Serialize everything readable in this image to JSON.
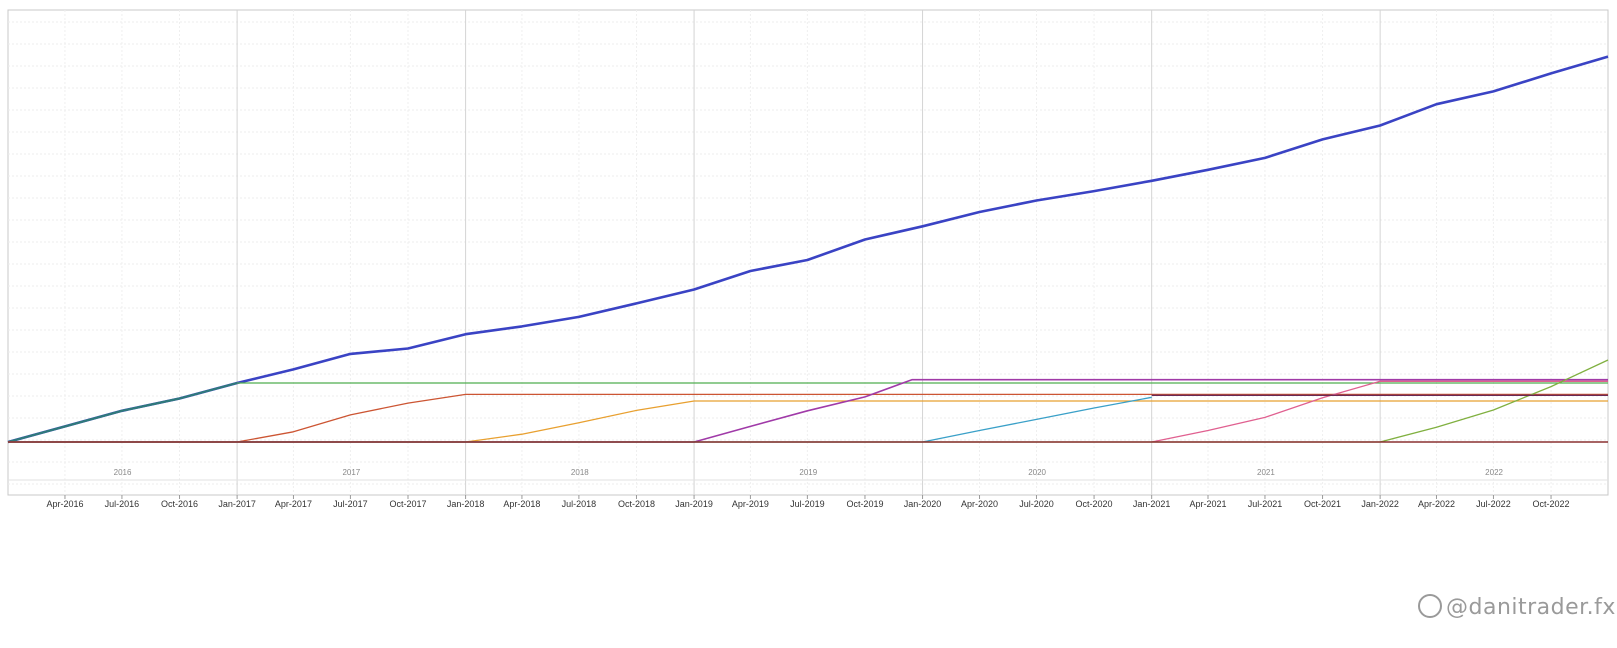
{
  "chart_data": {
    "type": "line",
    "title": "",
    "xlabel": "",
    "ylabel": "",
    "xlim": [
      "2016-01-01",
      "2022-12-31"
    ],
    "ylim": [
      0,
      100
    ],
    "grid": true,
    "legend": "none",
    "y_tick_labels_visible": false,
    "x_ticks": [
      "Apr-2016",
      "Jul-2016",
      "Oct-2016",
      "Jan-2017",
      "Apr-2017",
      "Jul-2017",
      "Oct-2017",
      "Jan-2018",
      "Apr-2018",
      "Jul-2018",
      "Oct-2018",
      "Jan-2019",
      "Apr-2019",
      "Jul-2019",
      "Oct-2019",
      "Jan-2020",
      "Apr-2020",
      "Jul-2020",
      "Oct-2020",
      "Jan-2021",
      "Apr-2021",
      "Jul-2021",
      "Oct-2021",
      "Jan-2022",
      "Apr-2022",
      "Jul-2022",
      "Oct-2022"
    ],
    "year_labels": [
      "2016",
      "2017",
      "2018",
      "2019",
      "2020",
      "2021",
      "2022"
    ],
    "series": [
      {
        "color": "#3a43c4",
        "width": 2.6,
        "x": [
          "2016-01-01",
          "2016-04-01",
          "2016-07-01",
          "2016-10-01",
          "2017-01-01",
          "2017-04-01",
          "2017-07-01",
          "2017-10-01",
          "2018-01-01",
          "2018-04-01",
          "2018-07-01",
          "2018-10-01",
          "2019-01-01",
          "2019-04-01",
          "2019-07-01",
          "2019-10-01",
          "2020-01-01",
          "2020-04-01",
          "2020-07-01",
          "2020-10-01",
          "2021-01-01",
          "2021-04-01",
          "2021-07-01",
          "2021-10-01",
          "2022-01-01",
          "2022-04-01",
          "2022-07-01",
          "2022-10-01",
          "2022-12-31"
        ],
        "y": [
          0,
          3.8,
          7.6,
          10.6,
          14.4,
          17.7,
          21.5,
          22.8,
          26.3,
          28.2,
          30.5,
          33.8,
          37.2,
          41.7,
          44.4,
          49.4,
          52.6,
          56.1,
          58.9,
          61.2,
          63.7,
          66.4,
          69.3,
          73.8,
          77.2,
          82.4,
          85.5,
          89.9,
          94.0
        ]
      },
      {
        "color": "#2f7a7a",
        "width": 2.2,
        "x": [
          "2016-01-01",
          "2016-04-01",
          "2016-07-01",
          "2016-10-01",
          "2017-01-01"
        ],
        "y": [
          0,
          3.8,
          7.6,
          10.6,
          14.4
        ]
      },
      {
        "color": "#4fae4f",
        "width": 1.3,
        "x": [
          "2017-01-01",
          "2022-12-31"
        ],
        "y": [
          14.4,
          14.4
        ]
      },
      {
        "color": "#cc5533",
        "width": 1.3,
        "x": [
          "2016-01-01",
          "2017-01-01",
          "2017-04-01",
          "2017-07-01",
          "2017-10-01",
          "2018-01-01",
          "2022-12-31"
        ],
        "y": [
          0,
          0,
          2.5,
          6.6,
          9.5,
          11.6,
          11.6
        ]
      },
      {
        "color": "#e8a030",
        "width": 1.3,
        "x": [
          "2016-01-01",
          "2018-01-01",
          "2018-04-01",
          "2018-07-01",
          "2018-10-01",
          "2019-01-01",
          "2022-12-31"
        ],
        "y": [
          0,
          0,
          1.9,
          4.7,
          7.7,
          10.0,
          10.0
        ]
      },
      {
        "color": "#a03aa8",
        "width": 1.6,
        "x": [
          "2016-01-01",
          "2019-01-01",
          "2019-04-01",
          "2019-07-01",
          "2019-10-01",
          "2019-12-15",
          "2022-12-31"
        ],
        "y": [
          0,
          0,
          3.8,
          7.6,
          11.0,
          15.2,
          15.2
        ]
      },
      {
        "color": "#3aa0c8",
        "width": 1.3,
        "x": [
          "2016-01-01",
          "2020-01-01",
          "2020-04-01",
          "2020-07-01",
          "2020-10-01",
          "2021-01-01"
        ],
        "y": [
          0,
          0,
          2.8,
          5.5,
          8.3,
          10.9
        ]
      },
      {
        "color": "#e06090",
        "width": 1.3,
        "x": [
          "2021-01-01",
          "2021-04-01",
          "2021-07-01",
          "2021-10-01",
          "2022-01-01",
          "2022-12-31"
        ],
        "y": [
          0,
          2.8,
          6.0,
          10.8,
          14.8,
          14.8
        ]
      },
      {
        "color": "#80b040",
        "width": 1.3,
        "x": [
          "2016-01-01",
          "2022-01-01",
          "2022-04-01",
          "2022-07-01",
          "2022-10-01",
          "2022-12-31"
        ],
        "y": [
          0,
          0,
          3.6,
          7.8,
          13.5,
          20.0
        ]
      },
      {
        "color": "#8a3030",
        "width": 1.6,
        "x": [
          "2016-01-01",
          "2022-12-31"
        ],
        "y": [
          0,
          0
        ]
      },
      {
        "color": "#6a2a55",
        "width": 1.4,
        "x": [
          "2021-01-01",
          "2022-12-31"
        ],
        "y": [
          11.4,
          11.4
        ]
      }
    ]
  },
  "watermark": {
    "icon": "weibo-icon",
    "text": "@danitrader.fx"
  }
}
